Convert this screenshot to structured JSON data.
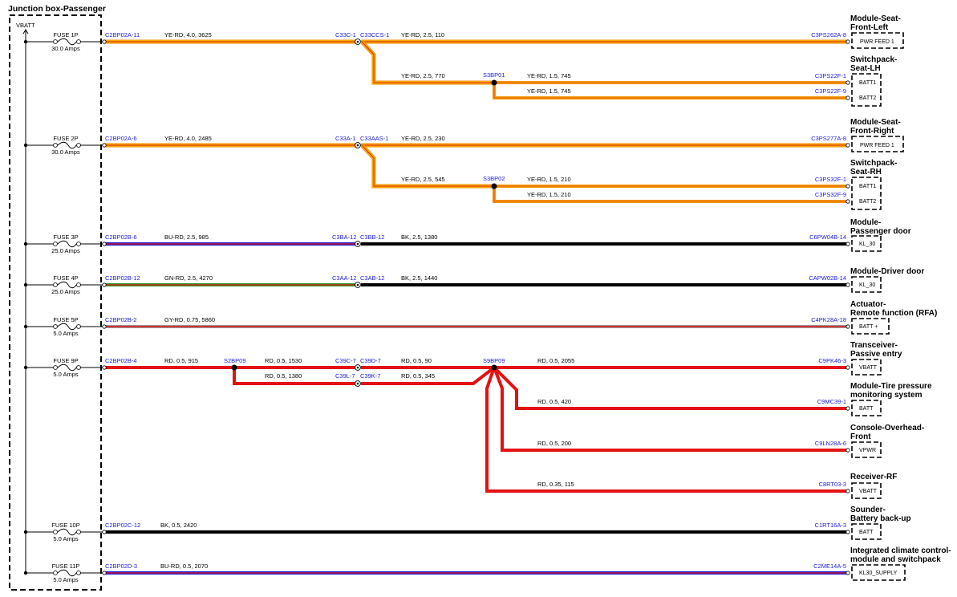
{
  "title": "Junction box-Passenger",
  "vbatt": "VBATT",
  "fuses": [
    {
      "label": "FUSE 1P",
      "amps": "30.0 Amps"
    },
    {
      "label": "FUSE 2P",
      "amps": "30.0 Amps"
    },
    {
      "label": "FUSE 3P",
      "amps": "25.0 Amps"
    },
    {
      "label": "FUSE 4P",
      "amps": "25.0 Amps"
    },
    {
      "label": "FUSE 5P",
      "amps": "5.0 Amps"
    },
    {
      "label": "FUSE 9P",
      "amps": "5.0 Amps"
    },
    {
      "label": "FUSE 10P",
      "amps": "5.0 Amps"
    },
    {
      "label": "FUSE 11P",
      "amps": "5.0 Amps"
    }
  ],
  "connectors": {
    "c1": "C2BP02A-11",
    "c2": "C2BP02A-6",
    "c3": "C2BP02B-6",
    "c4": "C2BP02B-12",
    "c5": "C2BP02B-2",
    "c6": "C2BP02B-4",
    "c7": "C2BP02C-12",
    "c8": "C2BP02D-3",
    "m1a": "C33C-1",
    "m1b": "C33CCS-1",
    "m2a": "C33A-1",
    "m2b": "C33AAS-1",
    "m3a": "C3BA-12",
    "m3b": "C3BB-12",
    "m4a": "C3AA-12",
    "m4b": "C3AB-12",
    "m5a": "C39C-7",
    "m5b": "C39D-7",
    "m6a": "C39L-7",
    "m6b": "C39K-7",
    "s1": "S3BP01",
    "s2": "S3BP02",
    "s3": "S2BP09",
    "s4": "S9BP09",
    "e1": "C3PS262A-8",
    "e2": "C3PS22F-1",
    "e3": "C3PS22F-9",
    "e4": "C3PS277A-8",
    "e5": "C3PS32F-1",
    "e6": "C3PS32F-9",
    "e7": "C6PW04B-14",
    "e8": "CAPW02B-14",
    "e9": "C4PK28A-18",
    "e10": "C9PK46-3",
    "e11": "C9MC39-1",
    "e12": "C9LN28A-6",
    "e13": "C8RT03-3",
    "e14": "C1RT16A-3",
    "e15": "C2ME14A-5"
  },
  "wires": {
    "w1": "YE-RD,  4.0,  3625",
    "w2": "YE-RD,  2.5,  110",
    "w3": "YE-RD,  2.5,  770",
    "w4": "YE-RD,  1.5,  745",
    "w5": "YE-RD,  1.5,  745",
    "w6": "YE-RD,  4.0,  2485",
    "w7": "YE-RD,  2.5,  230",
    "w8": "YE-RD,  2.5,  545",
    "w9": "YE-RD,  1.5,  210",
    "w10": "YE-RD,  1.5,  210",
    "w11": "BU-RD,  2.5,  985",
    "w12": "BK,  2.5,  1380",
    "w13": "GN-RD,  2.5,  4270",
    "w14": "BK,  2.5,  1440",
    "w15": "GY-RD,  0.75,  5860",
    "w16": "RD,  0.5,  915",
    "w17": "RD,  0.5,  1530",
    "w18": "RD,  0.5,  90",
    "w19": "RD,  0.5,  2055",
    "w20": "RD,  0.5,  1380",
    "w21": "RD,  0.5,  345",
    "w22": "RD,  0.5,  420",
    "w23": "RD,  0.5,  200",
    "w24": "RD,  0.35,  115",
    "w25": "BK,  0.5,  2420",
    "w26": "BU-RD,  0.5,  2070"
  },
  "destinations": [
    {
      "line1": "Module-Seat-",
      "line2": "Front-Left"
    },
    {
      "line1": "Switchpack-",
      "line2": "Seat-LH"
    },
    {
      "line1": "Module-Seat-",
      "line2": "Front-Right"
    },
    {
      "line1": "Switchpack-",
      "line2": "Seat-RH"
    },
    {
      "line1": "Module-",
      "line2": "Passenger door"
    },
    {
      "line1": "Module-Driver door",
      "line2": ""
    },
    {
      "line1": "Actuator-",
      "line2": "Remote function (RFA)"
    },
    {
      "line1": "Transceiver-",
      "line2": "Passive entry"
    },
    {
      "line1": "Module-Tire pressure",
      "line2": "monitoring system"
    },
    {
      "line1": "Console-Overhead-",
      "line2": "Front"
    },
    {
      "line1": "Receiver-RF",
      "line2": ""
    },
    {
      "line1": "Sounder-",
      "line2": "Battery back-up"
    },
    {
      "line1": "Integrated climate control-",
      "line2": "module and switchpack"
    }
  ],
  "pins": {
    "p1": "PWR FEED 1",
    "p2": "BATT1",
    "p3": "BATT2",
    "p4": "PWR FEED 1",
    "p5": "BATT1",
    "p6": "BATT2",
    "p7": "KL_30",
    "p8": "KL_30",
    "p9": "BATT +",
    "p10": "VBATT",
    "p11": "BATT",
    "p12": "VPWR",
    "p13": "VBATT",
    "p14": "BATT",
    "p15": "KL30_SUPPLY"
  },
  "colors": {
    "yellow": "#f5c000",
    "red": "#e31212",
    "blue": "#1b1bd4",
    "black": "#000000",
    "green": "#2f9a2f",
    "gray": "#9a9a9a",
    "orange": "#f08a00",
    "connector_text": "#1a1adc"
  }
}
